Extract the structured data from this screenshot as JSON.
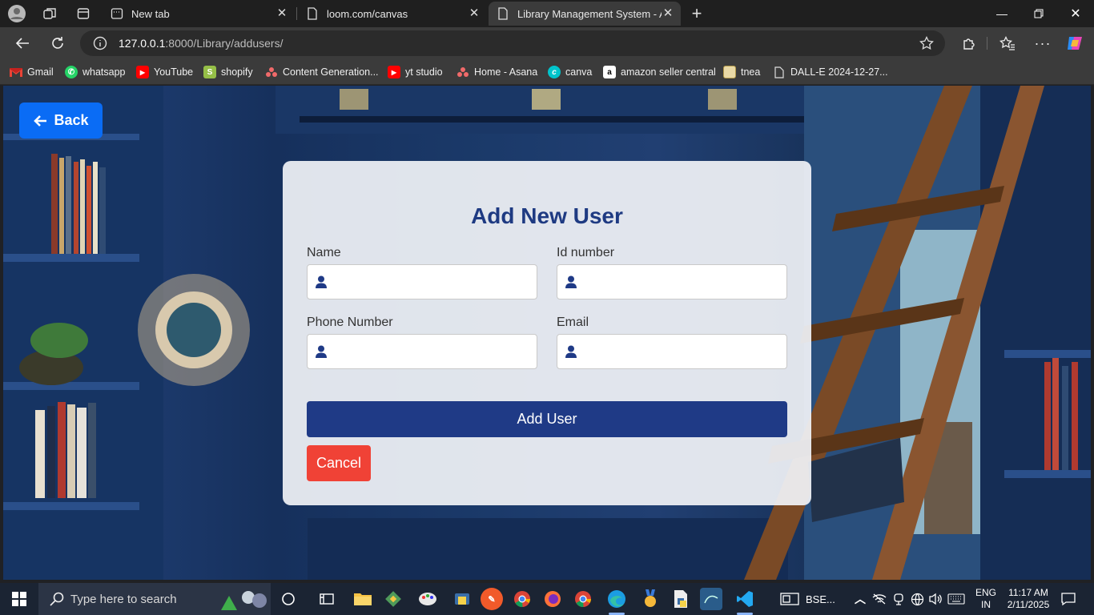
{
  "browser": {
    "tabs": [
      {
        "title": "New tab",
        "icon": "new-tab-icon"
      },
      {
        "title": "loom.com/canvas",
        "icon": "page-icon"
      },
      {
        "title": "Library Management System - Ad",
        "icon": "page-icon",
        "active": true
      }
    ],
    "address": {
      "host": "127.0.0.1",
      "path": ":8000/Library/addusers/"
    },
    "bookmarks": [
      {
        "label": "Gmail",
        "icon": "gmail-icon"
      },
      {
        "label": "whatsapp",
        "icon": "whatsapp-icon"
      },
      {
        "label": "YouTube",
        "icon": "youtube-icon"
      },
      {
        "label": "shopify",
        "icon": "shopify-icon"
      },
      {
        "label": "Content Generation...",
        "icon": "asana-icon"
      },
      {
        "label": "yt studio",
        "icon": "youtube-icon"
      },
      {
        "label": "Home - Asana",
        "icon": "asana-icon"
      },
      {
        "label": "canva",
        "icon": "canva-icon"
      },
      {
        "label": "amazon seller central",
        "icon": "amazon-icon"
      },
      {
        "label": "tnea",
        "icon": "tnea-icon"
      },
      {
        "label": "DALL-E 2024-12-27...",
        "icon": "file-icon"
      }
    ]
  },
  "page": {
    "back_label": "Back",
    "title": "Add New User",
    "fields": {
      "name": {
        "label": "Name",
        "value": ""
      },
      "id_number": {
        "label": "Id number",
        "value": ""
      },
      "phone": {
        "label": "Phone Number",
        "value": ""
      },
      "email": {
        "label": "Email",
        "value": ""
      }
    },
    "add_label": "Add User",
    "cancel_label": "Cancel"
  },
  "taskbar": {
    "search_placeholder": "Type here to search",
    "pinned_label": "BSE...",
    "language": "ENG",
    "region": "IN",
    "time": "11:17 AM",
    "date": "2/11/2025"
  },
  "colors": {
    "primary": "#1f3a86",
    "back": "#0a6cf5",
    "cancel": "#f04236",
    "title": "#1e3a82"
  }
}
